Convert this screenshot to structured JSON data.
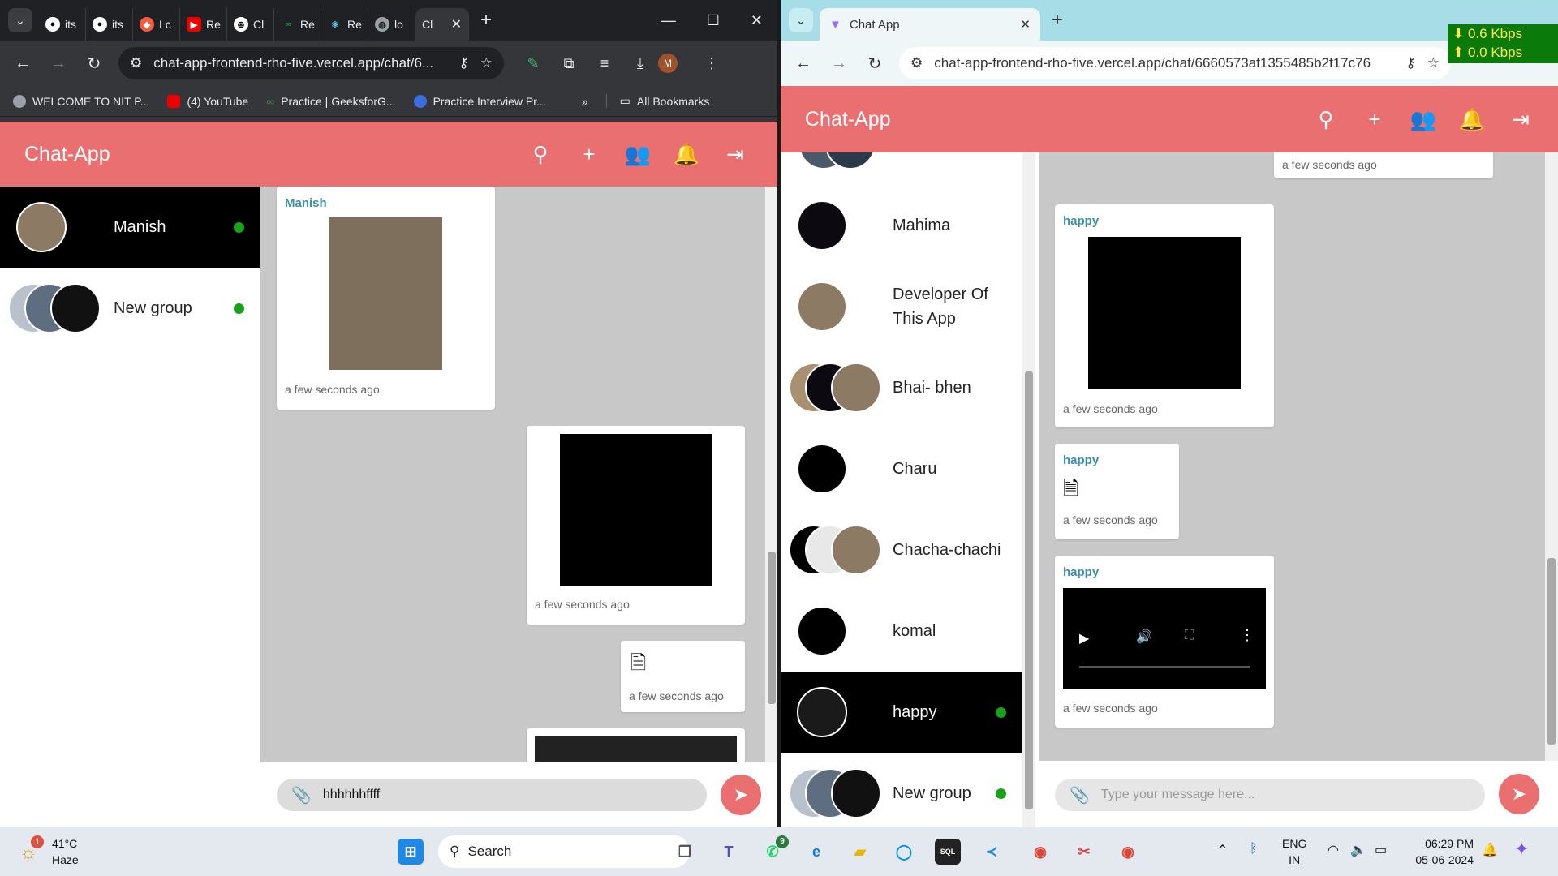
{
  "left_window": {
    "tabs": [
      "its",
      "its",
      "Lc",
      "Re",
      "Cl",
      "Re",
      "Re",
      "lo",
      "Cl"
    ],
    "url": "chat-app-frontend-rho-five.vercel.app/chat/6...",
    "profile_initial": "M",
    "bookmarks": [
      "WELCOME TO NIT P...",
      "(4) YouTube",
      "Practice | GeeksforG...",
      "Practice Interview Pr..."
    ],
    "all_bookmarks": "All Bookmarks",
    "app": {
      "brand": "Chat-App",
      "chats": [
        {
          "name": "Manish",
          "online": true,
          "active": true
        },
        {
          "name": "New group",
          "online": true,
          "active": false
        }
      ],
      "messages": [
        {
          "sender": "Manish",
          "time": "a few seconds ago"
        },
        {
          "time": "a few seconds ago"
        },
        {
          "time": "a few seconds ago"
        }
      ],
      "input_value": "hhhhhhffff"
    }
  },
  "right_window": {
    "tab_title": "Chat App",
    "url": "chat-app-frontend-rho-five.vercel.app/chat/6660573af1355485b2f17c76",
    "speed": {
      "down": "0.6 Kbps",
      "up": "0.0 Kbps"
    },
    "app": {
      "brand": "Chat-App",
      "chats": [
        {
          "name": "Mahima",
          "online": false,
          "active": false
        },
        {
          "name": "Developer Of This App",
          "online": false,
          "active": false
        },
        {
          "name": "Bhai- bhen",
          "online": false,
          "active": false
        },
        {
          "name": "Charu",
          "online": false,
          "active": false
        },
        {
          "name": "Chacha-chachi",
          "online": false,
          "active": false
        },
        {
          "name": "komal",
          "online": false,
          "active": false
        },
        {
          "name": "happy",
          "online": true,
          "active": true
        },
        {
          "name": "New group",
          "online": true,
          "active": false
        }
      ],
      "messages": [
        {
          "time": "a few seconds ago"
        },
        {
          "sender": "happy",
          "time": "a few seconds ago"
        },
        {
          "sender": "happy",
          "time": "a few seconds ago"
        },
        {
          "sender": "happy",
          "time": "a few seconds ago"
        }
      ],
      "input_placeholder": "Type your message here..."
    }
  },
  "taskbar": {
    "weather_temp": "41°C",
    "weather_desc": "Haze",
    "weather_badge": "1",
    "search_label": "Search",
    "lang_top": "ENG",
    "lang_bottom": "IN",
    "time": "06:29 PM",
    "date": "05-06-2024",
    "whatsapp_badge": "9"
  }
}
